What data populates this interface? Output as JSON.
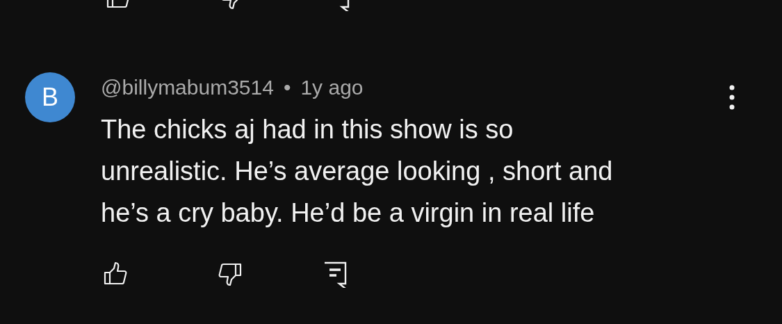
{
  "comment": {
    "avatar_letter": "B",
    "author": "@billymabum3514",
    "separator": "•",
    "time": "1y ago",
    "text": "The chicks aj had in this show is so unrealistic. He’s average looking , short and he’s a cry baby. He’d be a virgin in real life"
  }
}
